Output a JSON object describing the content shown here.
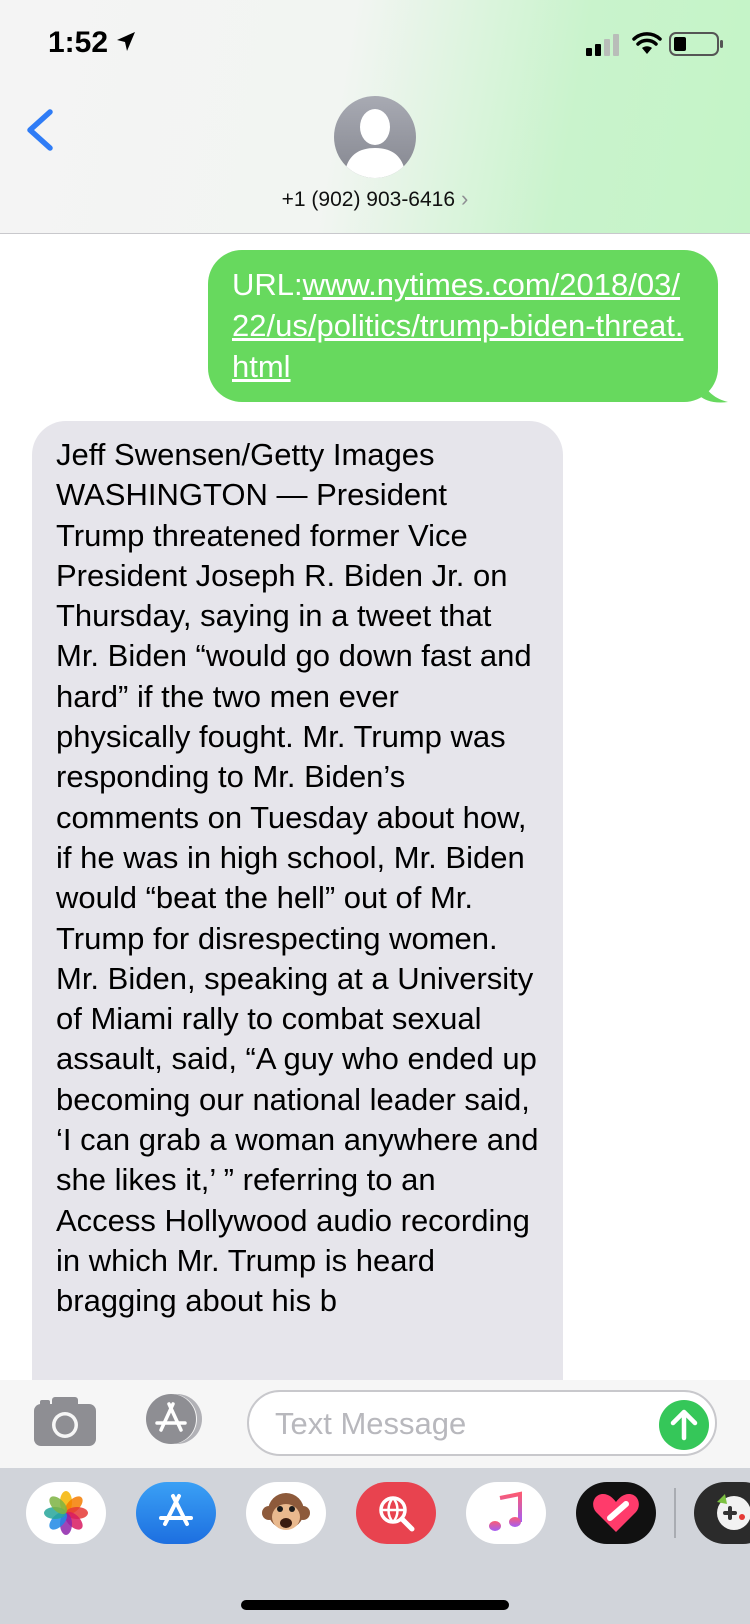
{
  "status_bar": {
    "time": "1:52"
  },
  "header": {
    "contact": "+1 (902) 903-6416",
    "contact_chevron": "›"
  },
  "messages": {
    "sent": {
      "prefix": "URL:",
      "link": "www.nytimes.com/2018/03/22/us/politics/trump-biden-threat.html"
    },
    "received": {
      "text": "Jeff Swensen/Getty Images\nWASHINGTON — President Trump threatened former Vice President Joseph R. Biden Jr. on Thursday, saying in a tweet that Mr. Biden “would go down fast and hard” if the two men ever physically fought. Mr. Trump was responding to Mr. Biden’s comments on Tuesday about how, if he was in high school, Mr. Biden would “beat the hell” out of Mr. Trump for disrespecting women.\nMr. Biden, speaking at a University of Miami rally to combat sexual assault, said, “A guy who ended up becoming our national leader said, ‘I can grab a woman anywhere and she likes it,’ ” referring to an Access Hollywood audio recording in which Mr. Trump is heard bragging about his b"
    }
  },
  "input": {
    "placeholder": "Text Message"
  },
  "colors": {
    "sent_bubble": "#67d95e",
    "received_bubble": "#e6e5eb",
    "send_button": "#35c759",
    "back_blue": "#2f7cf6"
  },
  "app_drawer": {
    "apps": [
      "photos-icon",
      "app-store-icon",
      "animoji-icon",
      "web-search-icon",
      "music-icon",
      "heart-app-icon",
      "game-app-icon"
    ]
  }
}
